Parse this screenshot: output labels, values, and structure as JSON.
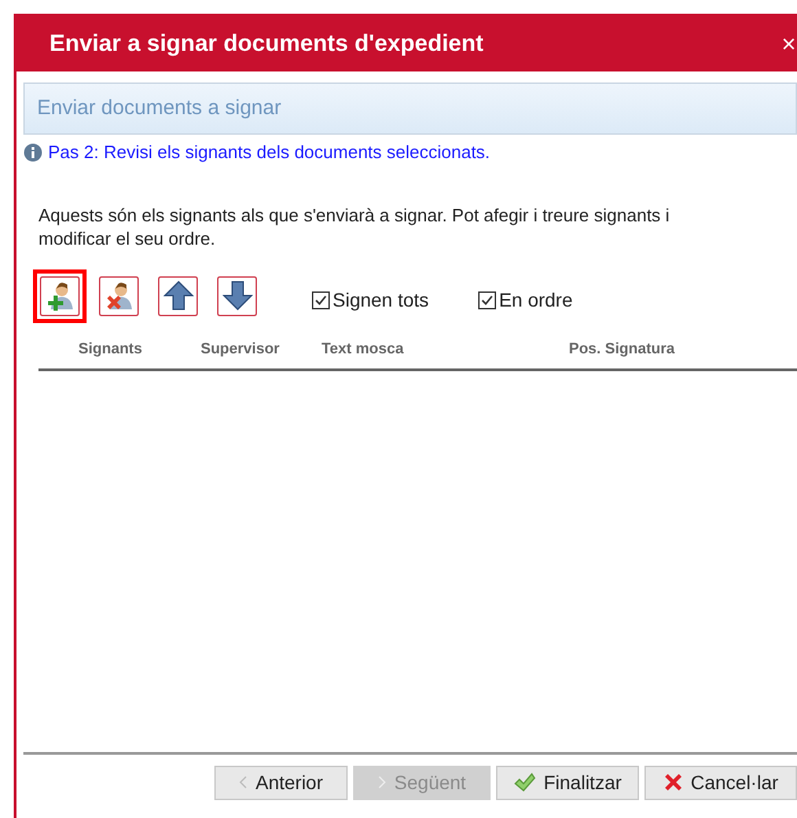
{
  "window": {
    "title": "Enviar a signar documents d'expedient",
    "close": "×"
  },
  "panel_title": "Enviar documents a signar",
  "step_info": "Pas 2: Revisi els signants dels documents seleccionats.",
  "description": "Aquests són els signants als que s'enviarà a signar. Pot afegir i treure signants i modificar el seu ordre.",
  "toolbar": [
    {
      "kind": "add-user",
      "focused": true
    },
    {
      "kind": "remove-user",
      "focused": false
    },
    {
      "kind": "up",
      "focused": false
    },
    {
      "kind": "down",
      "focused": false
    }
  ],
  "options": [
    {
      "label": "Signen tots",
      "checked": true
    },
    {
      "label": "En ordre",
      "checked": true
    }
  ],
  "table": {
    "columns": [
      "Signants",
      "Supervisor",
      "Text mosca",
      "Pos. Signatura"
    ]
  },
  "buttons": [
    {
      "kind": "prev",
      "label": "Anterior",
      "disabled": false
    },
    {
      "kind": "next",
      "label": "Següent",
      "disabled": true
    },
    {
      "kind": "finish",
      "label": "Finalitzar",
      "disabled": false
    },
    {
      "kind": "cancel",
      "label": "Cancel·lar",
      "disabled": false
    }
  ]
}
